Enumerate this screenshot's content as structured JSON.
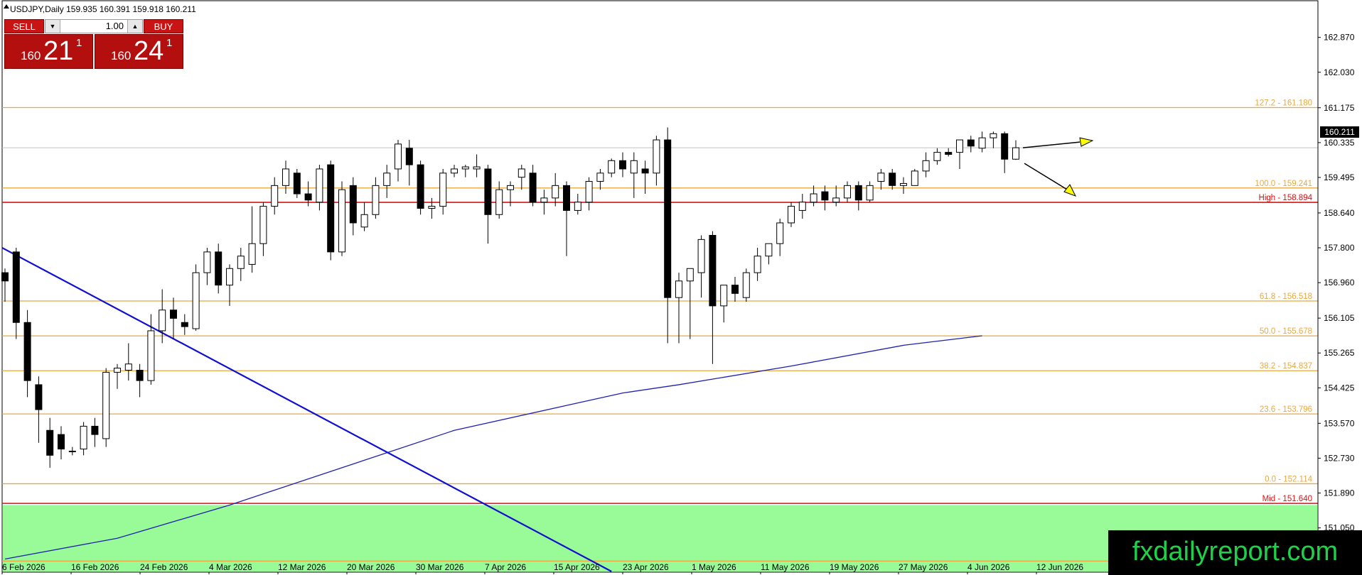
{
  "header": {
    "title": "USDJPY,Daily  159.935 160.391 159.918 160.211"
  },
  "trade_panel": {
    "sell_label": "SELL",
    "buy_label": "BUY",
    "lot": "1.00",
    "sell_price": {
      "prefix": "160",
      "big": "21",
      "sup": "1"
    },
    "buy_price": {
      "prefix": "160",
      "big": "24",
      "sup": "1"
    }
  },
  "watermark": "fxdailyreport.com",
  "current_price_tag": "160.211",
  "colors": {
    "fib": "#e8a840",
    "red_level": "#e01010",
    "trendline": "#1010d0",
    "ma": "#2020b0",
    "zone": "#98fb98",
    "watermark_text": "#1fd14a",
    "arrow": "#ffff00"
  },
  "chart_data": {
    "type": "candlestick",
    "symbol": "USDJPY",
    "timeframe": "Daily",
    "ylim": [
      150.0,
      163.6
    ],
    "y_ticks": [
      "162.870",
      "162.030",
      "161.175",
      "160.335",
      "159.495",
      "158.640",
      "157.800",
      "156.960",
      "156.105",
      "155.265",
      "154.425",
      "153.570",
      "152.730",
      "151.890",
      "151.050"
    ],
    "x_ticks": [
      "6 Feb 2026",
      "16 Feb 2026",
      "24 Feb 2026",
      "4 Mar 2026",
      "12 Mar 2026",
      "20 Mar 2026",
      "30 Mar 2026",
      "7 Apr 2026",
      "15 Apr 2026",
      "23 Apr 2026",
      "1 May 2026",
      "11 May 2026",
      "19 May 2026",
      "27 May 2026",
      "4 Jun 2026",
      "12 Jun 2026"
    ],
    "levels": [
      {
        "label": "127.2 - 161.180",
        "value": 161.18,
        "kind": "fib"
      },
      {
        "label": "100.0 - 159.241",
        "value": 159.241,
        "kind": "fib"
      },
      {
        "label": "High - 158.894",
        "value": 158.894,
        "kind": "red"
      },
      {
        "label": "61.8 - 156.518",
        "value": 156.518,
        "kind": "fib"
      },
      {
        "label": "50.0 - 155.678",
        "value": 155.678,
        "kind": "fib"
      },
      {
        "label": "38.2 - 154.837",
        "value": 154.837,
        "kind": "fib"
      },
      {
        "label": "23.6 - 153.796",
        "value": 153.796,
        "kind": "fib"
      },
      {
        "label": "0.0 - 152.114",
        "value": 152.114,
        "kind": "fib"
      },
      {
        "label": "Mid - 151.640",
        "value": 151.64,
        "kind": "red"
      },
      {
        "label": "",
        "value": 150.25,
        "kind": "fib"
      }
    ],
    "zone": {
      "top": 151.6,
      "bottom": 150.0
    },
    "trendline": {
      "from": [
        0,
        157.8
      ],
      "to": [
        54,
        150.0
      ]
    },
    "moving_average": [
      [
        0,
        150.3
      ],
      [
        10,
        150.8
      ],
      [
        20,
        151.6
      ],
      [
        30,
        152.5
      ],
      [
        40,
        153.4
      ],
      [
        50,
        154.0
      ],
      [
        55,
        154.3
      ],
      [
        60,
        154.5
      ],
      [
        70,
        154.95
      ],
      [
        80,
        155.45
      ],
      [
        87,
        155.68
      ]
    ],
    "candles": [
      {
        "o": 157.2,
        "h": 157.3,
        "l": 156.5,
        "c": 157.0
      },
      {
        "o": 157.7,
        "h": 157.8,
        "l": 155.6,
        "c": 156.0
      },
      {
        "o": 156.0,
        "h": 156.3,
        "l": 154.2,
        "c": 154.6
      },
      {
        "o": 154.5,
        "h": 154.7,
        "l": 153.1,
        "c": 153.9
      },
      {
        "o": 153.4,
        "h": 153.7,
        "l": 152.5,
        "c": 152.8
      },
      {
        "o": 153.3,
        "h": 153.5,
        "l": 152.7,
        "c": 152.95
      },
      {
        "o": 152.9,
        "h": 153.0,
        "l": 152.8,
        "c": 152.9
      },
      {
        "o": 152.95,
        "h": 153.6,
        "l": 152.8,
        "c": 153.5
      },
      {
        "o": 153.5,
        "h": 153.7,
        "l": 153.0,
        "c": 153.3
      },
      {
        "o": 153.2,
        "h": 154.9,
        "l": 153.0,
        "c": 154.8
      },
      {
        "o": 154.8,
        "h": 155.0,
        "l": 154.4,
        "c": 154.9
      },
      {
        "o": 154.85,
        "h": 155.5,
        "l": 154.6,
        "c": 155.0
      },
      {
        "o": 154.85,
        "h": 155.0,
        "l": 154.2,
        "c": 154.6
      },
      {
        "o": 154.6,
        "h": 156.2,
        "l": 154.5,
        "c": 155.8
      },
      {
        "o": 155.8,
        "h": 156.8,
        "l": 155.5,
        "c": 156.3
      },
      {
        "o": 156.3,
        "h": 156.6,
        "l": 155.6,
        "c": 156.1
      },
      {
        "o": 156.0,
        "h": 156.2,
        "l": 155.7,
        "c": 155.9
      },
      {
        "o": 155.85,
        "h": 157.4,
        "l": 155.8,
        "c": 157.2
      },
      {
        "o": 157.2,
        "h": 157.8,
        "l": 156.9,
        "c": 157.7
      },
      {
        "o": 157.7,
        "h": 157.9,
        "l": 156.7,
        "c": 156.9
      },
      {
        "o": 156.9,
        "h": 157.4,
        "l": 156.4,
        "c": 157.3
      },
      {
        "o": 157.3,
        "h": 157.8,
        "l": 157.0,
        "c": 157.6
      },
      {
        "o": 157.4,
        "h": 158.8,
        "l": 157.2,
        "c": 157.9
      },
      {
        "o": 157.9,
        "h": 158.9,
        "l": 157.6,
        "c": 158.8
      },
      {
        "o": 158.8,
        "h": 159.5,
        "l": 158.6,
        "c": 159.3
      },
      {
        "o": 159.3,
        "h": 159.9,
        "l": 159.1,
        "c": 159.7
      },
      {
        "o": 159.6,
        "h": 159.7,
        "l": 159.0,
        "c": 159.1
      },
      {
        "o": 159.1,
        "h": 159.4,
        "l": 158.8,
        "c": 158.95
      },
      {
        "o": 158.9,
        "h": 159.8,
        "l": 158.7,
        "c": 159.7
      },
      {
        "o": 159.8,
        "h": 159.9,
        "l": 157.5,
        "c": 157.7
      },
      {
        "o": 157.7,
        "h": 159.4,
        "l": 157.6,
        "c": 159.2
      },
      {
        "o": 159.3,
        "h": 159.5,
        "l": 158.1,
        "c": 158.4
      },
      {
        "o": 158.3,
        "h": 158.9,
        "l": 158.2,
        "c": 158.6
      },
      {
        "o": 158.6,
        "h": 159.5,
        "l": 158.5,
        "c": 159.3
      },
      {
        "o": 159.3,
        "h": 159.8,
        "l": 159.0,
        "c": 159.6
      },
      {
        "o": 159.7,
        "h": 160.4,
        "l": 159.4,
        "c": 160.3
      },
      {
        "o": 160.2,
        "h": 160.4,
        "l": 159.3,
        "c": 159.8
      },
      {
        "o": 159.8,
        "h": 159.9,
        "l": 158.6,
        "c": 158.75
      },
      {
        "o": 158.75,
        "h": 159.0,
        "l": 158.5,
        "c": 158.8
      },
      {
        "o": 158.8,
        "h": 159.7,
        "l": 158.6,
        "c": 159.6
      },
      {
        "o": 159.6,
        "h": 159.8,
        "l": 159.5,
        "c": 159.7
      },
      {
        "o": 159.7,
        "h": 159.8,
        "l": 159.5,
        "c": 159.75
      },
      {
        "o": 159.7,
        "h": 160.05,
        "l": 159.5,
        "c": 159.75
      },
      {
        "o": 159.7,
        "h": 159.8,
        "l": 157.9,
        "c": 158.6
      },
      {
        "o": 158.6,
        "h": 159.4,
        "l": 158.5,
        "c": 159.2
      },
      {
        "o": 159.2,
        "h": 159.4,
        "l": 158.8,
        "c": 159.3
      },
      {
        "o": 159.5,
        "h": 159.8,
        "l": 159.2,
        "c": 159.7
      },
      {
        "o": 159.6,
        "h": 159.8,
        "l": 158.8,
        "c": 158.9
      },
      {
        "o": 158.9,
        "h": 159.2,
        "l": 158.6,
        "c": 159.0
      },
      {
        "o": 159.0,
        "h": 159.6,
        "l": 158.8,
        "c": 159.3
      },
      {
        "o": 159.3,
        "h": 159.4,
        "l": 157.6,
        "c": 158.7
      },
      {
        "o": 158.7,
        "h": 159.1,
        "l": 158.6,
        "c": 158.9
      },
      {
        "o": 158.9,
        "h": 159.5,
        "l": 158.7,
        "c": 159.4
      },
      {
        "o": 159.4,
        "h": 159.7,
        "l": 159.2,
        "c": 159.6
      },
      {
        "o": 159.6,
        "h": 159.95,
        "l": 159.5,
        "c": 159.9
      },
      {
        "o": 159.9,
        "h": 160.1,
        "l": 159.5,
        "c": 159.7
      },
      {
        "o": 159.6,
        "h": 160.1,
        "l": 159.0,
        "c": 159.9
      },
      {
        "o": 159.7,
        "h": 159.9,
        "l": 159.1,
        "c": 159.6
      },
      {
        "o": 159.6,
        "h": 160.5,
        "l": 159.3,
        "c": 160.4
      },
      {
        "o": 160.4,
        "h": 160.7,
        "l": 155.5,
        "c": 156.6
      },
      {
        "o": 156.6,
        "h": 157.2,
        "l": 155.5,
        "c": 157.0
      },
      {
        "o": 157.0,
        "h": 157.3,
        "l": 155.6,
        "c": 157.3
      },
      {
        "o": 157.2,
        "h": 158.1,
        "l": 156.6,
        "c": 158.0
      },
      {
        "o": 158.1,
        "h": 158.2,
        "l": 155.0,
        "c": 156.4
      },
      {
        "o": 156.4,
        "h": 156.9,
        "l": 156.0,
        "c": 156.9
      },
      {
        "o": 156.9,
        "h": 157.1,
        "l": 156.5,
        "c": 156.7
      },
      {
        "o": 156.6,
        "h": 157.3,
        "l": 156.5,
        "c": 157.2
      },
      {
        "o": 157.2,
        "h": 157.8,
        "l": 157.0,
        "c": 157.6
      },
      {
        "o": 157.6,
        "h": 157.9,
        "l": 157.4,
        "c": 157.9
      },
      {
        "o": 157.9,
        "h": 158.5,
        "l": 157.6,
        "c": 158.4
      },
      {
        "o": 158.4,
        "h": 158.9,
        "l": 158.3,
        "c": 158.8
      },
      {
        "o": 158.7,
        "h": 159.1,
        "l": 158.5,
        "c": 158.9
      },
      {
        "o": 158.9,
        "h": 159.3,
        "l": 158.8,
        "c": 159.1
      },
      {
        "o": 159.15,
        "h": 159.3,
        "l": 158.7,
        "c": 158.95
      },
      {
        "o": 158.9,
        "h": 159.3,
        "l": 158.8,
        "c": 159.0
      },
      {
        "o": 159.0,
        "h": 159.4,
        "l": 158.9,
        "c": 159.3
      },
      {
        "o": 159.3,
        "h": 159.4,
        "l": 158.7,
        "c": 158.95
      },
      {
        "o": 158.95,
        "h": 159.4,
        "l": 158.9,
        "c": 159.3
      },
      {
        "o": 159.4,
        "h": 159.7,
        "l": 159.2,
        "c": 159.6
      },
      {
        "o": 159.6,
        "h": 159.7,
        "l": 159.2,
        "c": 159.3
      },
      {
        "o": 159.3,
        "h": 159.5,
        "l": 159.1,
        "c": 159.35
      },
      {
        "o": 159.3,
        "h": 159.7,
        "l": 159.3,
        "c": 159.65
      },
      {
        "o": 159.65,
        "h": 160.1,
        "l": 159.5,
        "c": 159.9
      },
      {
        "o": 159.9,
        "h": 160.2,
        "l": 159.8,
        "c": 160.1
      },
      {
        "o": 160.1,
        "h": 160.2,
        "l": 160.0,
        "c": 160.05
      },
      {
        "o": 160.1,
        "h": 160.4,
        "l": 159.7,
        "c": 160.4
      },
      {
        "o": 160.4,
        "h": 160.5,
        "l": 160.1,
        "c": 160.25
      },
      {
        "o": 160.2,
        "h": 160.6,
        "l": 160.1,
        "c": 160.45
      },
      {
        "o": 160.45,
        "h": 160.6,
        "l": 160.2,
        "c": 160.55
      },
      {
        "o": 160.55,
        "h": 160.6,
        "l": 159.6,
        "c": 159.935
      },
      {
        "o": 159.935,
        "h": 160.391,
        "l": 159.918,
        "c": 160.211
      }
    ]
  }
}
